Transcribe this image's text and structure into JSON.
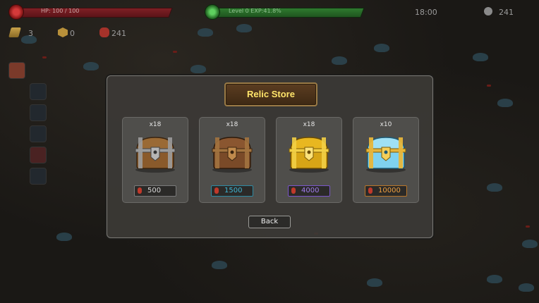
{
  "hud": {
    "hp_text": "HP: 100 / 100",
    "level_text": "Level 0   EXP:41.8%",
    "level_progress": 0.418,
    "time": "18:00",
    "kills": "241"
  },
  "resources": [
    {
      "icon": "gold-bar-icon",
      "value": "3"
    },
    {
      "icon": "gold-coin-icon",
      "value": "0"
    },
    {
      "icon": "red-gem-icon",
      "value": "241"
    }
  ],
  "skills": [
    "fire-skill-icon",
    "skill-icon-2",
    "skill-icon-3",
    "skill-icon-4",
    "skill-icon-5",
    "skill-icon-6"
  ],
  "store": {
    "title": "Relic Store",
    "back_label": "Back",
    "chests": [
      {
        "name": "iron-chest",
        "qty": "x18",
        "price": "500",
        "price_color": "#d8d8d8",
        "border_color": "#7a7a7a",
        "chest_color": "#8a5a2b",
        "band_color": "#9c9c9c"
      },
      {
        "name": "bronze-chest",
        "qty": "x18",
        "price": "1500",
        "price_color": "#3fb7d6",
        "border_color": "#2e8aa3",
        "chest_color": "#7a4a28",
        "band_color": "#a2733f"
      },
      {
        "name": "gold-chest",
        "qty": "x18",
        "price": "4000",
        "price_color": "#a27cf0",
        "border_color": "#7a55c9",
        "chest_color": "#d7a516",
        "band_color": "#f2cf45"
      },
      {
        "name": "crystal-chest",
        "qty": "x10",
        "price": "10000",
        "price_color": "#f0a040",
        "border_color": "#b8752a",
        "chest_color": "#7fd2ef",
        "band_color": "#e7b53a"
      }
    ]
  }
}
